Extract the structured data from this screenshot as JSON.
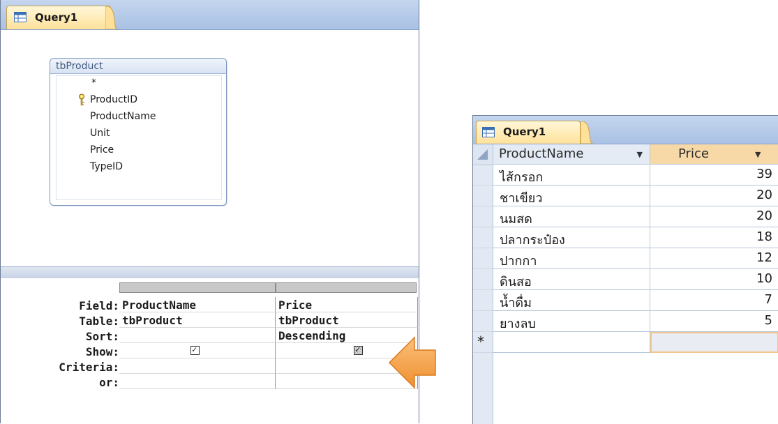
{
  "design": {
    "tab_title": "Query1",
    "table_box": {
      "name": "tbProduct",
      "fields": [
        "*",
        "ProductID",
        "ProductName",
        "Unit",
        "Price",
        "TypeID"
      ],
      "primary_key": "ProductID"
    },
    "grid": {
      "row_labels": [
        "Field:",
        "Table:",
        "Sort:",
        "Show:",
        "Criteria:",
        "or:"
      ],
      "columns": [
        {
          "field": "ProductName",
          "table": "tbProduct",
          "sort": "",
          "show": true,
          "criteria": "",
          "or": ""
        },
        {
          "field": "Price",
          "table": "tbProduct",
          "sort": "Descending",
          "show": true,
          "criteria": "",
          "or": ""
        }
      ]
    }
  },
  "result": {
    "tab_title": "Query1",
    "headers": [
      "ProductName",
      "Price"
    ],
    "rows": [
      {
        "name": "ไส้กรอก",
        "price": "39"
      },
      {
        "name": "ชาเขียว",
        "price": "20"
      },
      {
        "name": "นมสด",
        "price": "20"
      },
      {
        "name": "ปลากระป๋อง",
        "price": "18"
      },
      {
        "name": "ปากกา",
        "price": "12"
      },
      {
        "name": "ดินสอ",
        "price": "10"
      },
      {
        "name": "น้ำดื่ม",
        "price": "7"
      },
      {
        "name": "ยางลบ",
        "price": "5"
      }
    ],
    "new_row_marker": "*"
  },
  "icons": {
    "query-icon": "datasheet-query",
    "key-icon": "primary-key",
    "arrow": "orange-left-arrow"
  },
  "colors": {
    "tab_active": "#ffe19a",
    "tabstrip": "#a9c1e4",
    "arrow": "#f0a04b",
    "header_selected": "#f7d9a8"
  }
}
